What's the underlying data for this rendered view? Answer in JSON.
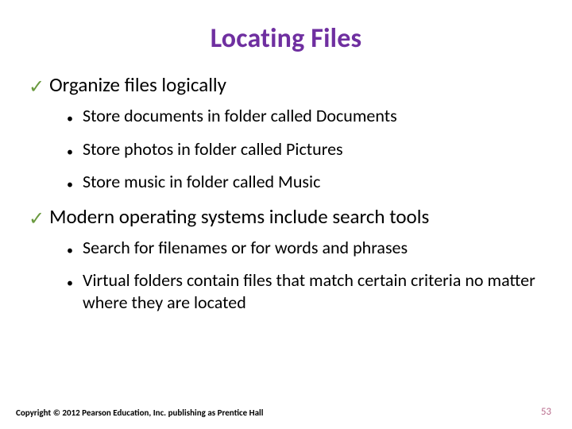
{
  "title": "Locating Files",
  "checkmark": "✓",
  "bullet_dot": "•",
  "sections": [
    {
      "heading": "Organize files logically",
      "items": [
        "Store documents in folder called Documents",
        "Store photos in folder called Pictures",
        "Store music in folder called Music"
      ]
    },
    {
      "heading": "Modern operating systems include search tools",
      "items": [
        "Search for filenames or for words and phrases",
        "Virtual folders contain files that match certain criteria no matter where they are located"
      ]
    }
  ],
  "footer": {
    "copyright": "Copyright © 2012 Pearson Education, Inc. publishing as Prentice Hall",
    "page": "53"
  }
}
